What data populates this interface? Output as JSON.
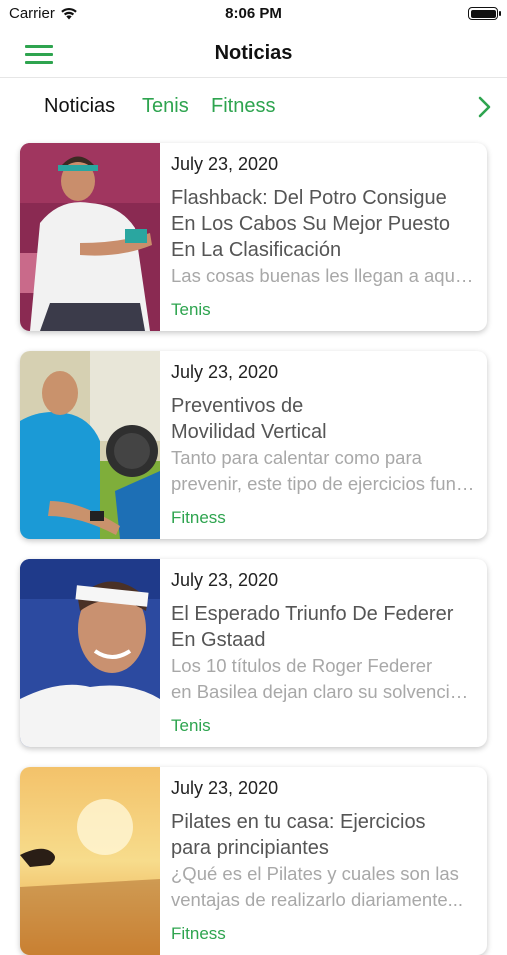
{
  "status_bar": {
    "carrier": "Carrier",
    "time": "8:06 PM"
  },
  "nav": {
    "title": "Noticias"
  },
  "tabs": [
    {
      "label": "Noticias",
      "active": true
    },
    {
      "label": "Tenis",
      "active": false
    },
    {
      "label": "Fitness",
      "active": false
    }
  ],
  "colors": {
    "accent": "#2ea44f"
  },
  "articles": [
    {
      "date": "July 23, 2020",
      "title_lines": [
        "Flashback: Del Potro Consigue",
        "En Los Cabos Su Mejor Puesto",
        "En La Clasificación"
      ],
      "excerpt_lines": [
        "Las cosas buenas les llegan a aquellos que..."
      ],
      "category": "Tenis"
    },
    {
      "date": "July 23, 2020",
      "title_lines": [
        "Preventivos de",
        "Movilidad Vertical"
      ],
      "excerpt_lines": [
        "Tanto para calentar como para",
        "prevenir, este tipo de ejercicios funcionan..."
      ],
      "category": "Fitness"
    },
    {
      "date": "July 23, 2020",
      "title_lines": [
        "El Esperado Triunfo De Federer",
        "En Gstaad"
      ],
      "excerpt_lines": [
        "Los 10 títulos de Roger Federer",
        "en Basilea dejan claro su solvencia..."
      ],
      "category": "Tenis"
    },
    {
      "date": "July 23, 2020",
      "title_lines": [
        "Pilates en tu casa: Ejercicios",
        "para principiantes"
      ],
      "excerpt_lines": [
        "¿Qué es el Pilates y cuales son las",
        "ventajas de realizarlo diariamente..."
      ],
      "category": "Fitness"
    }
  ]
}
